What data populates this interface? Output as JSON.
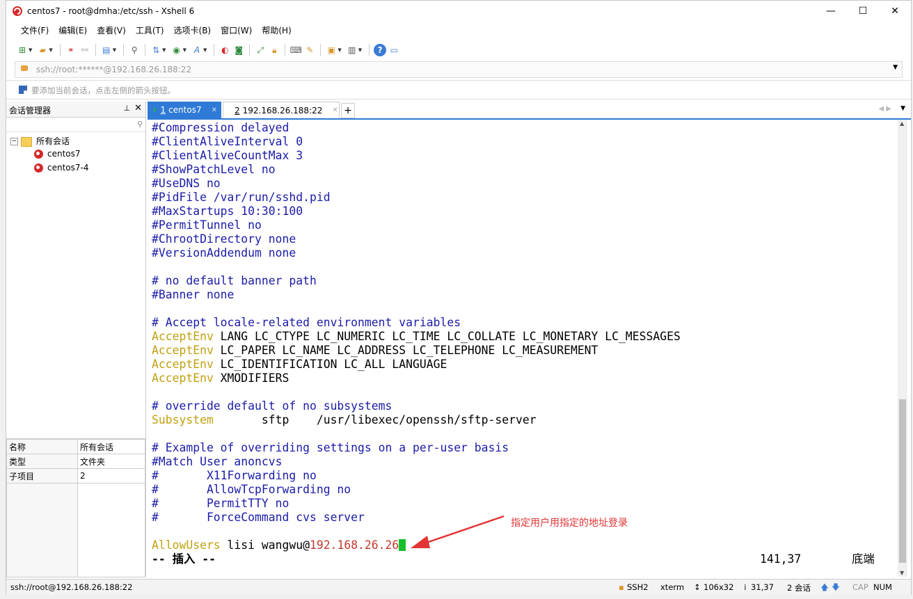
{
  "window": {
    "title": "centos7 - root@dmha:/etc/ssh - Xshell 6",
    "minimize": "—",
    "maximize": "☐",
    "close": "✕"
  },
  "menu": [
    "文件(F)",
    "编辑(E)",
    "查看(V)",
    "工具(T)",
    "选项卡(B)",
    "窗口(W)",
    "帮助(H)"
  ],
  "address": {
    "value": "ssh://root:******@192.168.26.188:22"
  },
  "hint": "要添加当前会话，点击左侧的箭头按钮。",
  "sidebar": {
    "title": "会话管理器",
    "tree": {
      "root": "所有会话",
      "items": [
        "centos7",
        "centos7-4"
      ]
    },
    "props": [
      {
        "k": "名称",
        "v": "所有会话"
      },
      {
        "k": "类型",
        "v": "文件夹"
      },
      {
        "k": "子项目",
        "v": "2"
      }
    ]
  },
  "tabs": [
    {
      "num": "1",
      "label": "centos7"
    },
    {
      "num": "2",
      "label": "192.168.26.188:22"
    }
  ],
  "terminal": {
    "lines": [
      "#Compression delayed",
      "#ClientAliveInterval 0",
      "#ClientAliveCountMax 3",
      "#ShowPatchLevel no",
      "#UseDNS no",
      "#PidFile /var/run/sshd.pid",
      "#MaxStartups 10:30:100",
      "#PermitTunnel no",
      "#ChrootDirectory none",
      "#VersionAddendum none",
      "",
      "# no default banner path",
      "#Banner none",
      "",
      "# Accept locale-related environment variables"
    ],
    "acceptenv_kw": "AcceptEnv",
    "acceptenv": [
      " LANG LC_CTYPE LC_NUMERIC LC_TIME LC_COLLATE LC_MONETARY LC_MESSAGES",
      " LC_PAPER LC_NAME LC_ADDRESS LC_TELEPHONE LC_MEASUREMENT",
      " LC_IDENTIFICATION LC_ALL LANGUAGE",
      " XMODIFIERS"
    ],
    "override_comment": "# override default of no subsystems",
    "subsystem_kw": "Subsystem",
    "subsystem_rest": "       sftp    /usr/libexec/openssh/sftp-server",
    "match_lines": [
      "# Example of overriding settings on a per-user basis",
      "#Match User anoncvs",
      "#       X11Forwarding no",
      "#       AllowTcpForwarding no",
      "#       PermitTTY no",
      "#       ForceCommand cvs server"
    ],
    "allow_kw": "AllowUsers",
    "allow_users": " lisi wangwu@",
    "allow_ip": "192.168.26.26",
    "mode": "-- 插入 --",
    "position": "141,37",
    "scroll_pos": "底端"
  },
  "annotation": "指定用户用指定的地址登录",
  "status": {
    "conn": "ssh://root@192.168.26.188:22",
    "proto": "SSH2",
    "term": "xterm",
    "size": "106x32",
    "cursor": "31,37",
    "sessions": "2 会话",
    "cap": "CAP",
    "num": "NUM"
  },
  "colors": {
    "comment": "#1b1ba8",
    "keyword": "#c0a010",
    "ip": "#c0392b",
    "cursor": "#15c02a",
    "tab_active": "#2f7ad6",
    "annotation": "#e23434"
  }
}
